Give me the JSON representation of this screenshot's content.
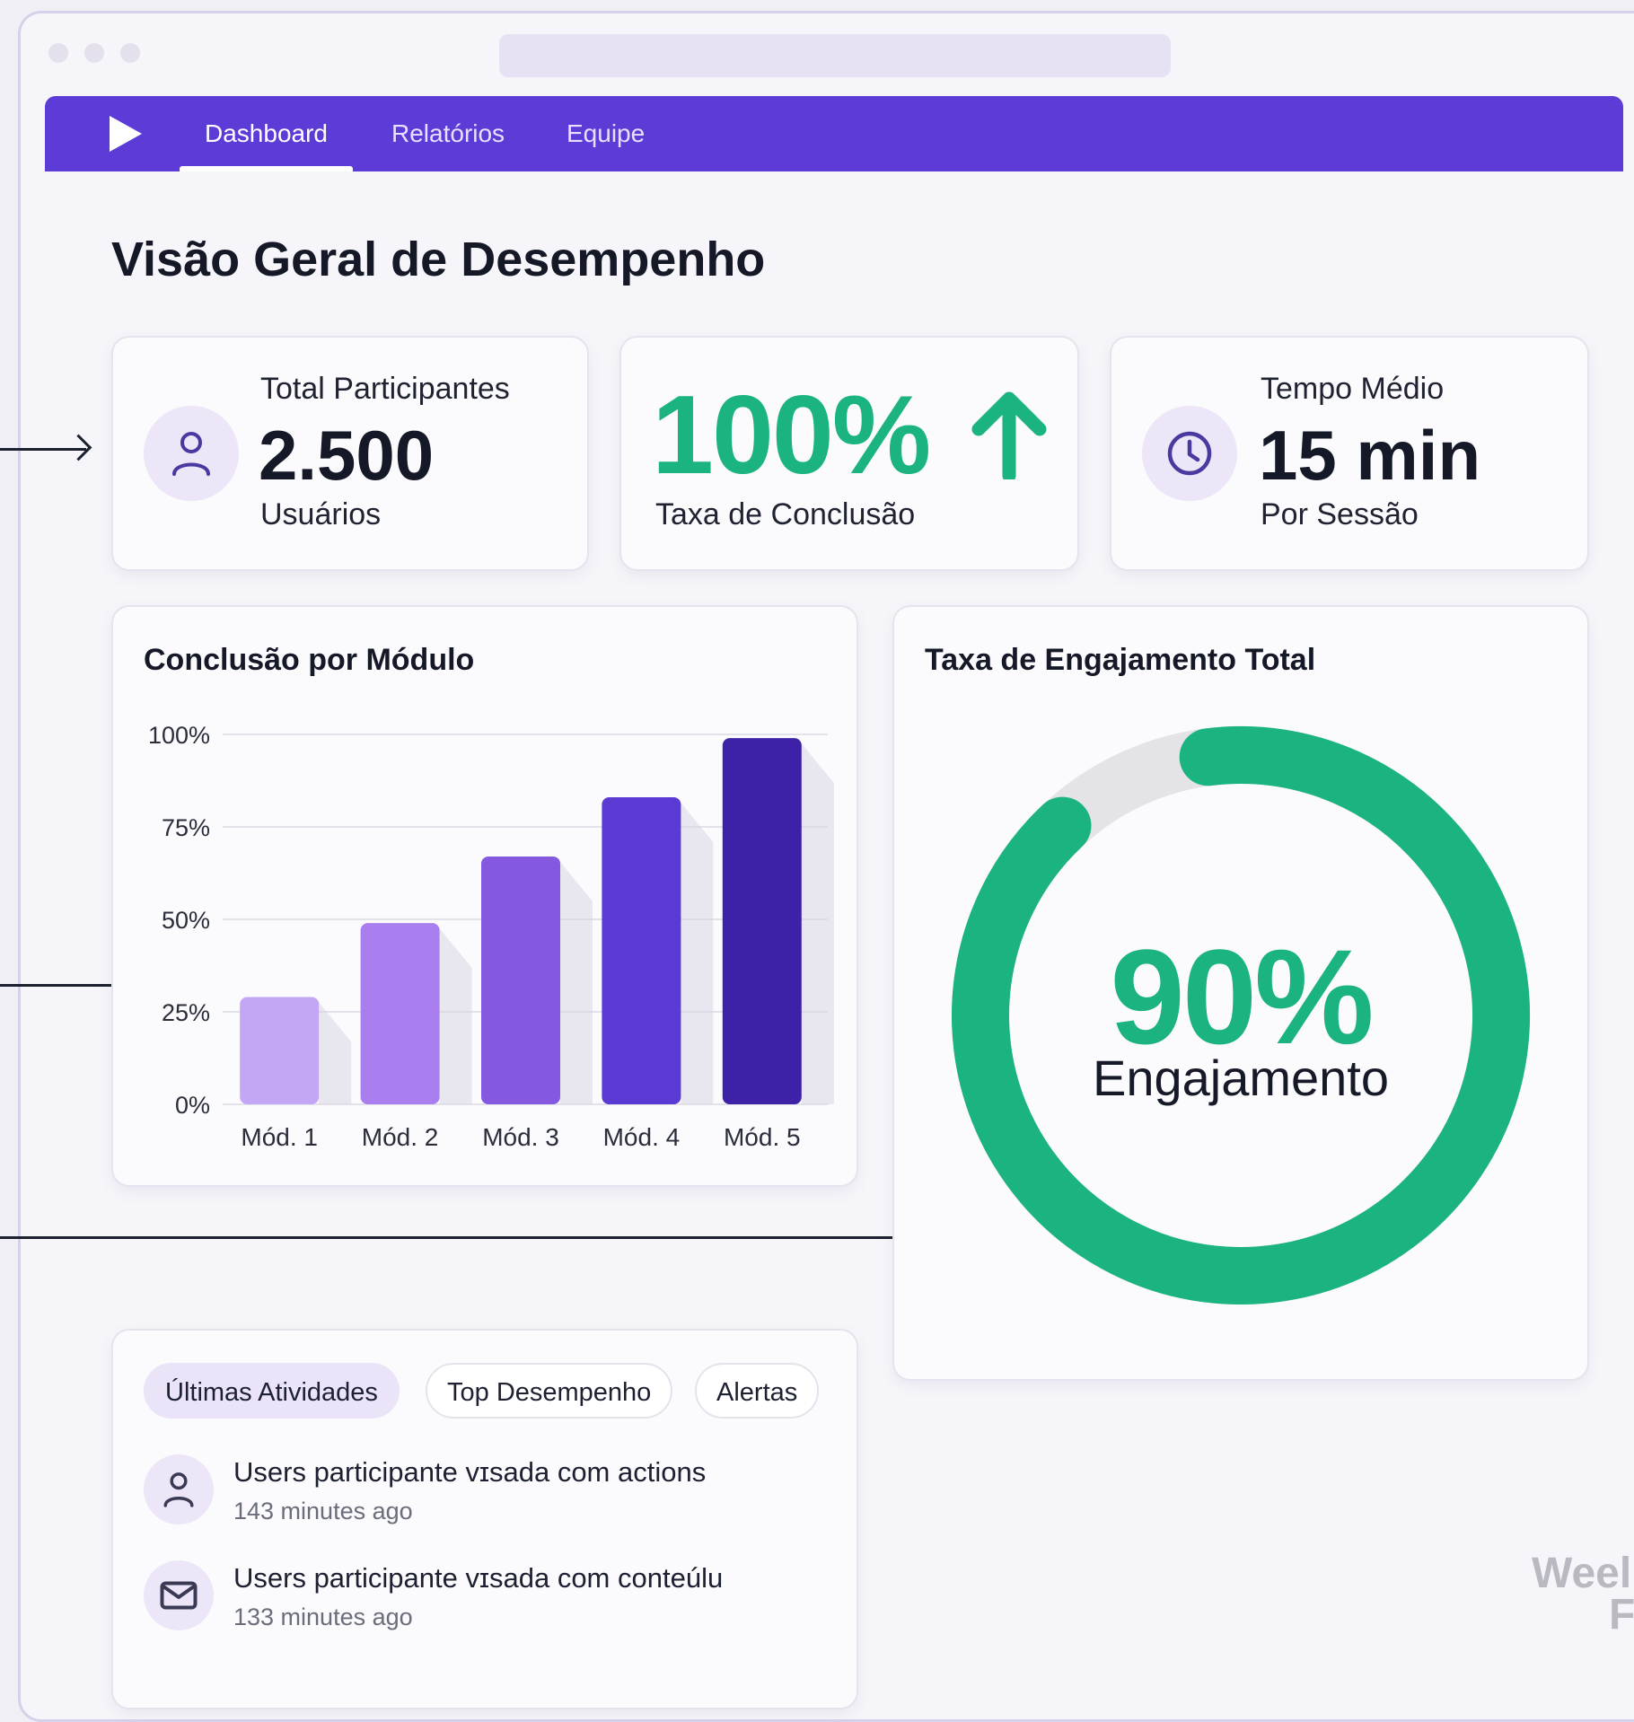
{
  "nav": {
    "items": [
      {
        "label": "Dashboard",
        "active": true
      },
      {
        "label": "Relatórios",
        "active": false
      },
      {
        "label": "Equipe",
        "active": false
      }
    ]
  },
  "page": {
    "title": "Visão Geral de Desempenho"
  },
  "stats": {
    "participants": {
      "label": "Total Participantes",
      "value": "2.500",
      "sub": "Usuários",
      "icon": "user-icon"
    },
    "completion": {
      "value": "100%",
      "sub": "Taxa de Conclusão",
      "icon": "arrow-up-icon"
    },
    "time": {
      "label": "Tempo Médio",
      "value": "15 min",
      "sub": "Por Sessão",
      "icon": "clock-icon"
    }
  },
  "colors": {
    "brand": "#5c3bd6",
    "accent_green": "#1bb37f",
    "ring_track": "#e3e3e8",
    "bars": [
      "#c4a7f4",
      "#a97ff0",
      "#8459e0",
      "#5b3ad4",
      "#3d22a8"
    ]
  },
  "chart_data": {
    "type": "bar",
    "title": "Conclusão por Módulo",
    "categories": [
      "Mód. 1",
      "Mód. 2",
      "Mód. 3",
      "Mód. 4",
      "Mód. 5"
    ],
    "values": [
      29,
      49,
      67,
      83,
      99
    ],
    "ylim": [
      0,
      100
    ],
    "yticks": [
      "0%",
      "25%",
      "50%",
      "75%",
      "100%"
    ],
    "ytick_values": [
      0,
      25,
      50,
      75,
      100
    ],
    "grid": true
  },
  "engagement": {
    "title": "Taxa de Engajamento Total",
    "value": "90%",
    "label": "Engajamento",
    "fraction": 0.9
  },
  "activity": {
    "tabs": [
      {
        "label": "Últimas Atividades",
        "active": true
      },
      {
        "label": "Top Desempenho",
        "active": false
      },
      {
        "label": "Alertas",
        "active": false
      }
    ],
    "items": [
      {
        "icon": "user-icon",
        "title": "Users participante vɪsada com actions",
        "time": "143 minutes ago"
      },
      {
        "icon": "mail-icon",
        "title": "Users participante vɪsada com conteúlu",
        "time": "133 minutes ago"
      }
    ]
  },
  "watermark": {
    "line1": "Weel",
    "line2": "F"
  }
}
